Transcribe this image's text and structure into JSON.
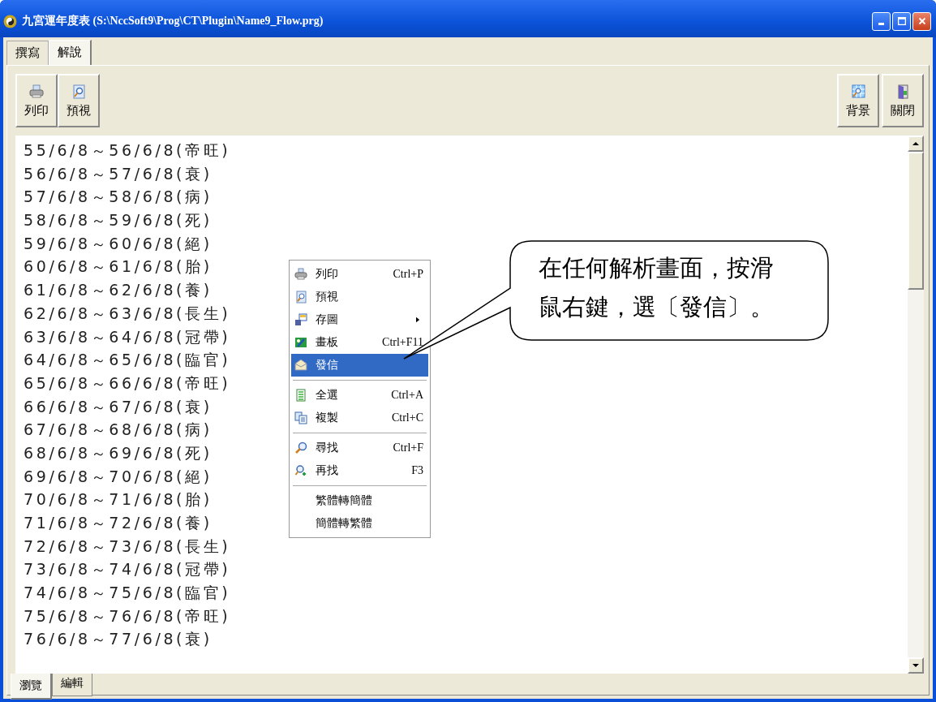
{
  "window": {
    "title": "九宮運年度表 (S:\\NccSoft9\\Prog\\CT\\Plugin\\Name9_Flow.prg)"
  },
  "tabs": [
    {
      "label": "撰寫",
      "selected": false
    },
    {
      "label": "解說",
      "selected": true
    }
  ],
  "toolbar_left": [
    {
      "label": "列印"
    },
    {
      "label": "預視"
    }
  ],
  "toolbar_right": [
    {
      "label": "背景"
    },
    {
      "label": "關閉"
    }
  ],
  "lines": [
    "55/6/8～56/6/8(帝旺)",
    "56/6/8～57/6/8(衰)",
    "57/6/8～58/6/8(病)",
    "58/6/8～59/6/8(死)",
    "59/6/8～60/6/8(絕)",
    "60/6/8～61/6/8(胎)",
    "61/6/8～62/6/8(養)",
    "62/6/8～63/6/8(長生)",
    "63/6/8～64/6/8(冠帶)",
    "64/6/8～65/6/8(臨官)",
    "65/6/8～66/6/8(帝旺)",
    "66/6/8～67/6/8(衰)",
    "67/6/8～68/6/8(病)",
    "68/6/8～69/6/8(死)",
    "69/6/8～70/6/8(絕)",
    "70/6/8～71/6/8(胎)",
    "71/6/8～72/6/8(養)",
    "72/6/8～73/6/8(長生)",
    "73/6/8～74/6/8(冠帶)",
    "74/6/8～75/6/8(臨官)",
    "75/6/8～76/6/8(帝旺)",
    "76/6/8～77/6/8(衰)"
  ],
  "context_menu": [
    {
      "kind": "item",
      "label": "列印",
      "shortcut": "Ctrl+P",
      "selected": false
    },
    {
      "kind": "item",
      "label": "預視",
      "selected": false
    },
    {
      "kind": "item",
      "label": "存圖",
      "has_submenu": true,
      "selected": false
    },
    {
      "kind": "item",
      "label": "畫板",
      "shortcut": "Ctrl+F11",
      "selected": false
    },
    {
      "kind": "item",
      "label": "發信",
      "selected": true
    },
    {
      "kind": "separator"
    },
    {
      "kind": "item",
      "label": "全選",
      "shortcut": "Ctrl+A",
      "selected": false
    },
    {
      "kind": "item",
      "label": "複製",
      "shortcut": "Ctrl+C",
      "selected": false
    },
    {
      "kind": "separator"
    },
    {
      "kind": "item",
      "label": "尋找",
      "shortcut": "Ctrl+F",
      "selected": false
    },
    {
      "kind": "item",
      "label": "再找",
      "shortcut": "F3",
      "selected": false
    },
    {
      "kind": "separator"
    },
    {
      "kind": "plain_item",
      "label": "繁體轉簡體",
      "selected": false
    },
    {
      "kind": "plain_item",
      "label": "簡體轉繁體",
      "selected": false
    }
  ],
  "callout": {
    "lines": [
      "在任何解析畫面，按滑",
      "鼠右鍵，選〔發信〕。"
    ]
  },
  "bottom_tabs": [
    {
      "label": "瀏覽",
      "selected": true
    },
    {
      "label": "編輯",
      "selected": false
    }
  ]
}
